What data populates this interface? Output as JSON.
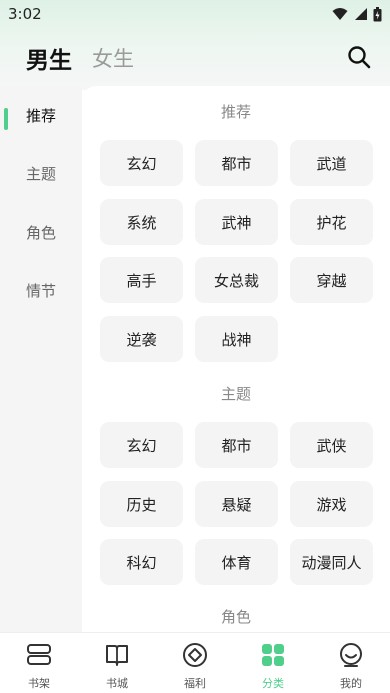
{
  "status_bar": {
    "time": "3:02"
  },
  "header": {
    "tabs": [
      {
        "label": "男生"
      },
      {
        "label": "女生"
      }
    ]
  },
  "sidebar": {
    "items": [
      {
        "label": "推荐"
      },
      {
        "label": "主题"
      },
      {
        "label": "角色"
      },
      {
        "label": "情节"
      }
    ]
  },
  "sections": [
    {
      "title": "推荐",
      "tags": [
        "玄幻",
        "都市",
        "武道",
        "系统",
        "武神",
        "护花",
        "高手",
        "女总裁",
        "穿越",
        "逆袭",
        "战神"
      ]
    },
    {
      "title": "主题",
      "tags": [
        "玄幻",
        "都市",
        "武侠",
        "历史",
        "悬疑",
        "游戏",
        "科幻",
        "体育",
        "动漫同人"
      ]
    },
    {
      "title": "角色",
      "tags": []
    }
  ],
  "bottom_nav": {
    "items": [
      {
        "label": "书架",
        "icon": "bookshelf-icon"
      },
      {
        "label": "书城",
        "icon": "book-icon"
      },
      {
        "label": "福利",
        "icon": "gift-icon"
      },
      {
        "label": "分类",
        "icon": "category-icon"
      },
      {
        "label": "我的",
        "icon": "profile-icon"
      }
    ]
  },
  "colors": {
    "accent": "#4fce8c",
    "chip_bg": "#f4f4f4",
    "sidebar_bg": "#f5f5f5"
  }
}
